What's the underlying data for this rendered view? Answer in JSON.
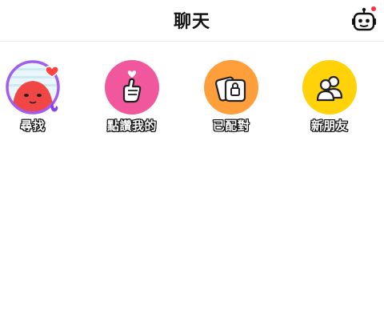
{
  "header": {
    "title": "聊天"
  },
  "shortcuts": [
    {
      "label": "尋找",
      "icon": "avatar-mascot-icon",
      "color": "#a25cf0"
    },
    {
      "label": "點讚我的",
      "icon": "finger-heart-icon",
      "color": "#f0579d"
    },
    {
      "label": "已配對",
      "icon": "matched-cards-icon",
      "color": "#ff9f3c"
    },
    {
      "label": "新朋友",
      "icon": "new-friends-icon",
      "color": "#ffd20a"
    }
  ]
}
